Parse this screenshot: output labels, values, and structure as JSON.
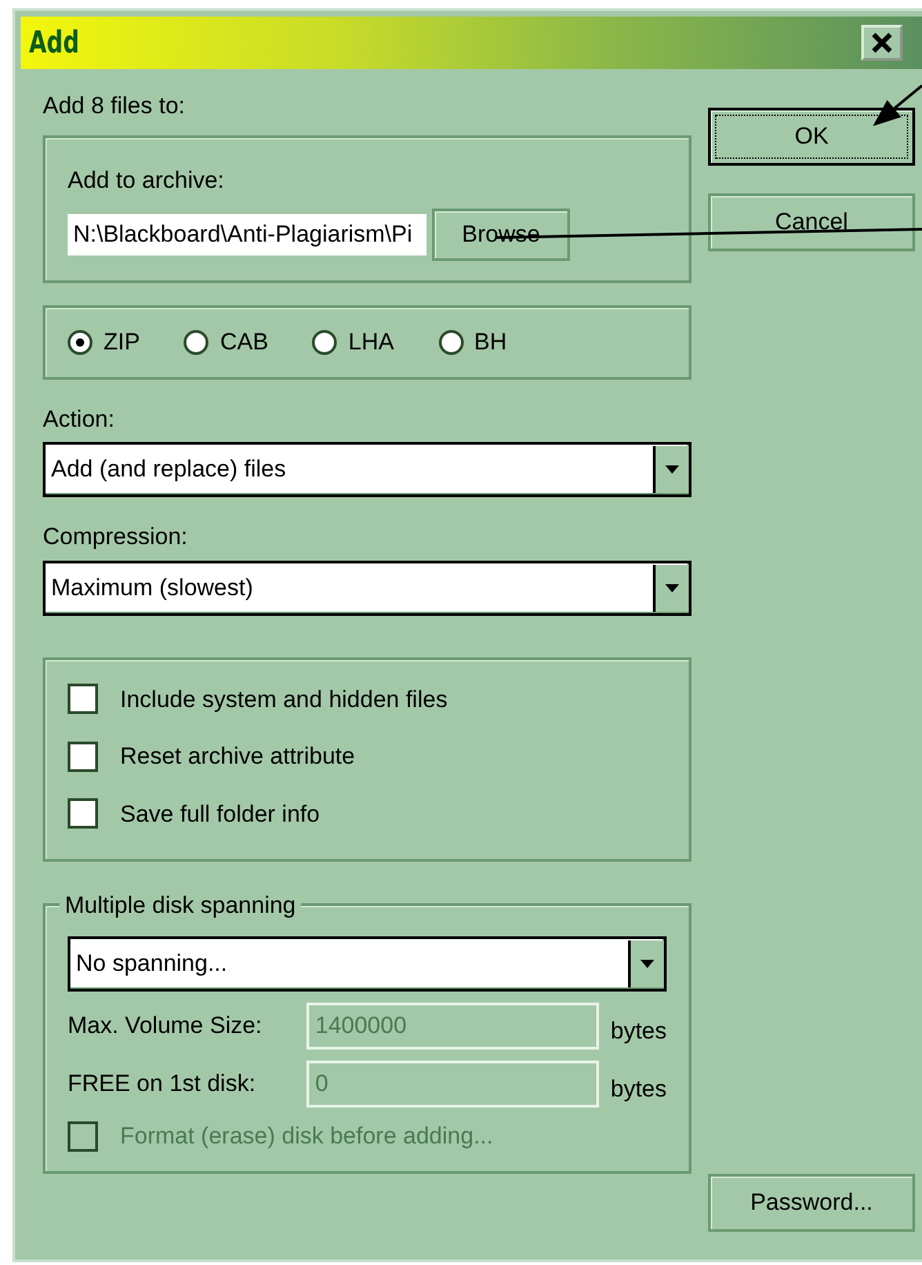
{
  "window": {
    "title": "Add"
  },
  "intro": "Add 8 files to:",
  "archive": {
    "label": "Add to archive:",
    "value": "N:\\Blackboard\\Anti-Plagiarism\\Pi",
    "browse": "Browse"
  },
  "formats": [
    {
      "label": "ZIP",
      "selected": true
    },
    {
      "label": "CAB",
      "selected": false
    },
    {
      "label": "LHA",
      "selected": false
    },
    {
      "label": "BH",
      "selected": false
    }
  ],
  "action": {
    "label": "Action:",
    "value": "Add (and replace) files"
  },
  "compression": {
    "label": "Compression:",
    "value": "Maximum (slowest)"
  },
  "options": [
    {
      "label": "Include system and hidden files",
      "checked": false,
      "disabled": false
    },
    {
      "label": "Reset archive attribute",
      "checked": false,
      "disabled": false
    },
    {
      "label": "Save full folder info",
      "checked": false,
      "disabled": false
    }
  ],
  "spanning": {
    "title": "Multiple disk spanning",
    "mode": "No spanning...",
    "fields": [
      {
        "label": "Max. Volume Size:",
        "value": "1400000",
        "unit": "bytes",
        "disabled": true
      },
      {
        "label": "FREE on 1st disk:",
        "value": "0",
        "unit": "bytes",
        "disabled": true
      }
    ],
    "format_option": {
      "label": "Format (erase) disk before adding...",
      "checked": false,
      "disabled": true
    }
  },
  "buttons": [
    {
      "label": "OK",
      "kind": "default"
    },
    {
      "label": "Cancel",
      "kind": "normal"
    },
    {
      "label": "Password...",
      "kind": "bottom"
    }
  ]
}
